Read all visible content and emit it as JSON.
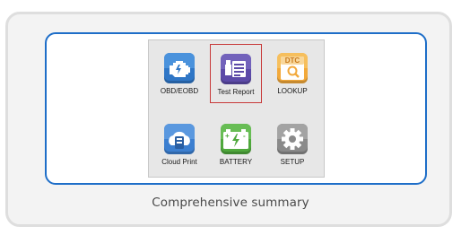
{
  "menu": {
    "items": [
      {
        "label": "OBD/EOBD",
        "icon": "engine-icon",
        "color": "#2f76c6",
        "selected": false
      },
      {
        "label": "Test Report",
        "icon": "test-report-icon",
        "color": "#5c4aa8",
        "selected": true
      },
      {
        "label": "LOOKUP",
        "icon": "dtc-lookup-icon",
        "color": "#f2a93b",
        "selected": false
      },
      {
        "label": "Cloud Print",
        "icon": "cloud-print-icon",
        "color": "#3c7fd0",
        "selected": false
      },
      {
        "label": "BATTERY",
        "icon": "battery-icon",
        "color": "#4fa83c",
        "selected": false
      },
      {
        "label": "SETUP",
        "icon": "gear-icon",
        "color": "#8a8a8a",
        "selected": false
      }
    ],
    "dtc_text": "DTC",
    "battery_plus": "+",
    "battery_minus": "-"
  },
  "caption": "Comprehensive summary",
  "colors": {
    "frame_border": "#1e6ec8",
    "selection_border": "#c83a3a",
    "card_background": "#f3f3f3"
  }
}
